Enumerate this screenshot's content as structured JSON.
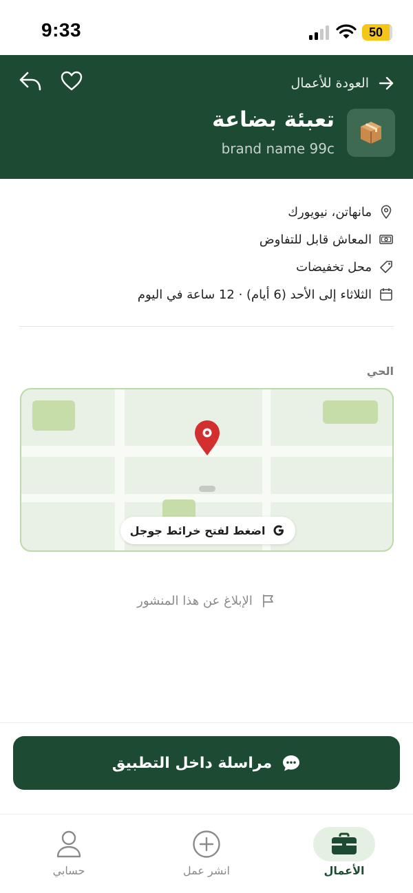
{
  "status_bar": {
    "time": "9:33",
    "battery": "50"
  },
  "header": {
    "back_label": "العودة للأعمال",
    "title": "تعبئة بضاعة",
    "brand": "brand name 99c",
    "logo_icon": "package-icon",
    "background_color": "#1c4a32"
  },
  "details": {
    "location": "مانهاتن، نيويورك",
    "salary": "المعاش قابل للتفاوض",
    "business_type": "محل تخفيضات",
    "schedule": "الثلاثاء إلى الأحد (6 أيام) · 12 ساعة في اليوم"
  },
  "map": {
    "section_label": "الحي",
    "cta_label": "اضغط لفتح خرائط جوجل"
  },
  "report": {
    "label": "الإبلاغ عن هذا المنشور"
  },
  "message_button": {
    "label": "مراسلة داخل التطبيق"
  },
  "bottom_nav": {
    "jobs": "الأعمال",
    "post_job": "انشر عمل",
    "account": "حسابي",
    "active_tab": "jobs"
  }
}
